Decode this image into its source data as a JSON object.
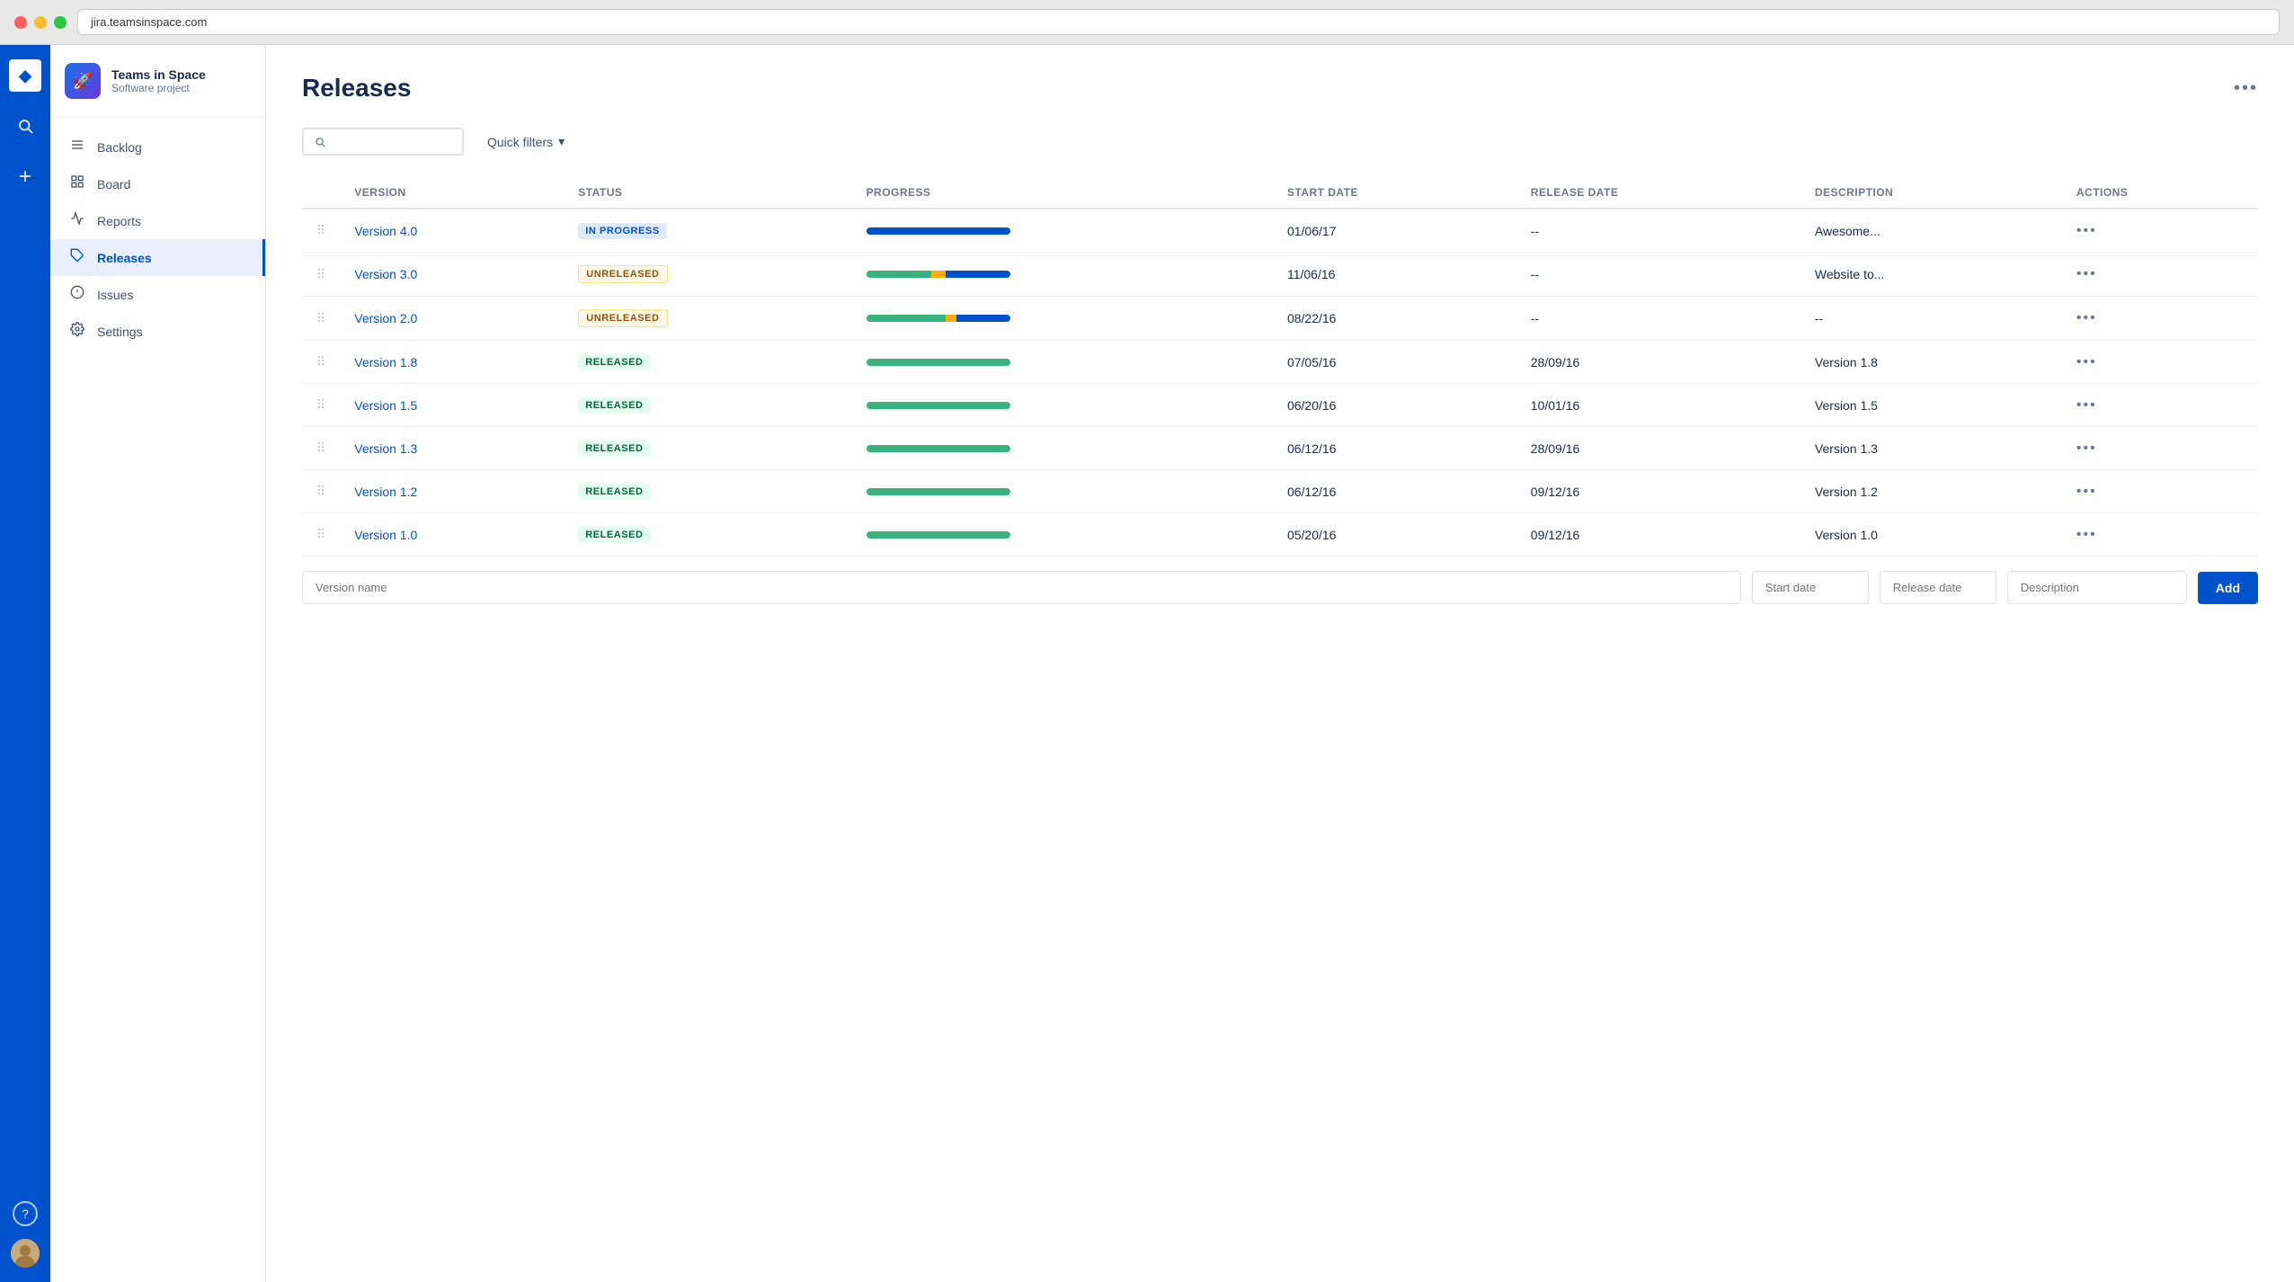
{
  "browser": {
    "url": "jira.teamsinspace.com"
  },
  "farNav": {
    "logo_icon": "◆",
    "search_icon": "🔍",
    "add_icon": "+",
    "help_icon": "?",
    "icons": [
      "◆",
      "🔍",
      "+"
    ]
  },
  "sidebar": {
    "project_name": "Teams in Space",
    "project_type": "Software project",
    "project_emoji": "🚀",
    "nav_items": [
      {
        "id": "backlog",
        "label": "Backlog",
        "icon": "☰",
        "active": false
      },
      {
        "id": "board",
        "label": "Board",
        "icon": "⊞",
        "active": false
      },
      {
        "id": "reports",
        "label": "Reports",
        "icon": "📈",
        "active": false
      },
      {
        "id": "releases",
        "label": "Releases",
        "icon": "🏷",
        "active": true
      },
      {
        "id": "issues",
        "label": "Issues",
        "icon": "⊡",
        "active": false
      },
      {
        "id": "settings",
        "label": "Settings",
        "icon": "⚙",
        "active": false
      }
    ]
  },
  "page": {
    "title": "Releases",
    "more_actions_label": "•••"
  },
  "toolbar": {
    "search_placeholder": "",
    "quick_filters_label": "Quick filters",
    "quick_filters_chevron": "▾"
  },
  "table": {
    "columns": [
      "",
      "Version",
      "Status",
      "Progress",
      "Start date",
      "Release date",
      "Description",
      "Actions"
    ],
    "rows": [
      {
        "version": "Version 4.0",
        "status": "IN PROGRESS",
        "status_type": "in-progress",
        "progress": {
          "blue": 100,
          "green": 0,
          "yellow": 0
        },
        "start_date": "01/06/17",
        "release_date": "--",
        "description": "Awesome...",
        "actions": "•••"
      },
      {
        "version": "Version 3.0",
        "status": "UNRELEASED",
        "status_type": "unreleased",
        "progress": {
          "green": 45,
          "yellow": 10,
          "blue": 45
        },
        "start_date": "11/06/16",
        "release_date": "--",
        "description": "Website to...",
        "actions": "•••"
      },
      {
        "version": "Version 2.0",
        "status": "UNRELEASED",
        "status_type": "unreleased",
        "progress": {
          "green": 55,
          "yellow": 8,
          "blue": 37
        },
        "start_date": "08/22/16",
        "release_date": "--",
        "description": "--",
        "actions": "•••"
      },
      {
        "version": "Version 1.8",
        "status": "RELEASED",
        "status_type": "released",
        "progress": {
          "green": 100,
          "yellow": 0,
          "blue": 0
        },
        "start_date": "07/05/16",
        "release_date": "28/09/16",
        "description": "Version 1.8",
        "actions": "•••"
      },
      {
        "version": "Version 1.5",
        "status": "RELEASED",
        "status_type": "released",
        "progress": {
          "green": 100,
          "yellow": 0,
          "blue": 0
        },
        "start_date": "06/20/16",
        "release_date": "10/01/16",
        "description": "Version 1.5",
        "actions": "•••"
      },
      {
        "version": "Version 1.3",
        "status": "RELEASED",
        "status_type": "released",
        "progress": {
          "green": 100,
          "yellow": 0,
          "blue": 0
        },
        "start_date": "06/12/16",
        "release_date": "28/09/16",
        "description": "Version 1.3",
        "actions": "•••"
      },
      {
        "version": "Version 1.2",
        "status": "RELEASED",
        "status_type": "released",
        "progress": {
          "green": 100,
          "yellow": 0,
          "blue": 0
        },
        "start_date": "06/12/16",
        "release_date": "09/12/16",
        "description": "Version 1.2",
        "actions": "•••"
      },
      {
        "version": "Version 1.0",
        "status": "RELEASED",
        "status_type": "released",
        "progress": {
          "green": 100,
          "yellow": 0,
          "blue": 0
        },
        "start_date": "05/20/16",
        "release_date": "09/12/16",
        "description": "Version 1.0",
        "actions": "•••"
      }
    ]
  },
  "add_form": {
    "version_placeholder": "Version name",
    "start_date_placeholder": "Start date",
    "release_date_placeholder": "Release date",
    "description_placeholder": "Description",
    "add_button_label": "Add"
  }
}
